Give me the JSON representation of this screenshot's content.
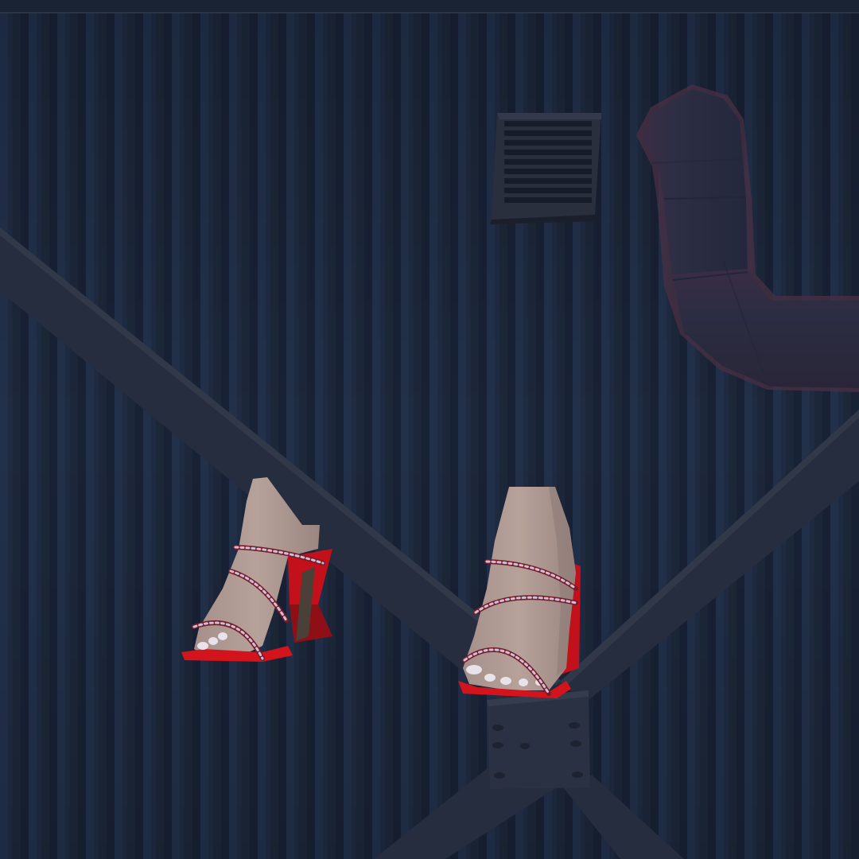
{
  "scene": {
    "description_visible_text": "",
    "colors": {
      "wall": "#1c2739",
      "wall_panel_light": "#23304a",
      "wall_panel_dark": "#172133",
      "beam": "#262d3e",
      "beam_edge": "#2f3749",
      "vent_frame": "#2a2f3e",
      "vent_slat": "#1c2230",
      "pipe": "#2c2e44",
      "pipe_rim": "#4a3044",
      "shoe_red": "#d3141c",
      "shoe_dark": "#8e0f16",
      "rhinestone": "#c9c2d6",
      "skin": "#b29c94",
      "skin_shadow": "#8f7b76",
      "toenail": "#e8e2ea"
    },
    "objects": [
      "corrugated-wall",
      "steel-beam-left",
      "steel-beam-right",
      "steel-beam-lower",
      "gusset-plate",
      "air-vent",
      "duct-pipe",
      "left-foot",
      "right-foot"
    ]
  }
}
